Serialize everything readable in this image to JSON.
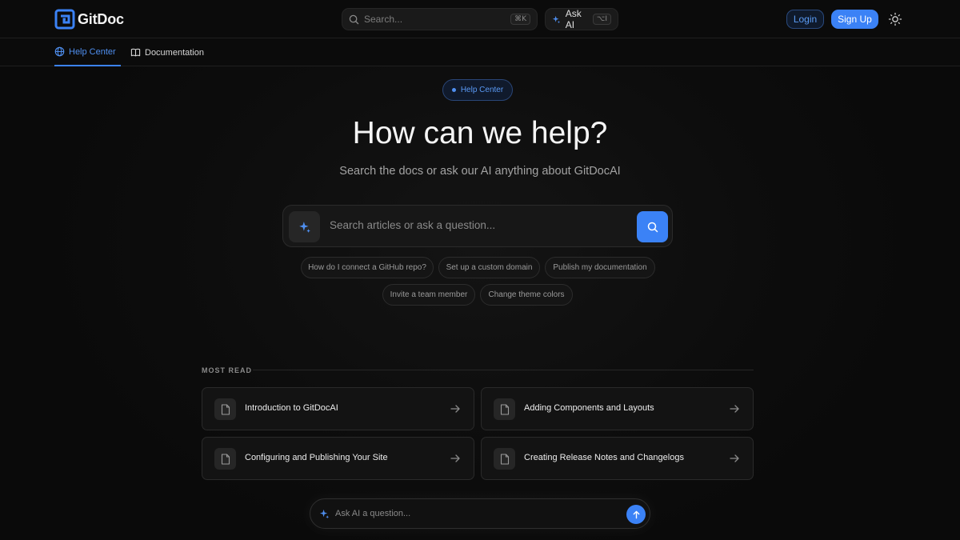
{
  "brand": {
    "name": "GitDoc",
    "accent": "#3b82f6"
  },
  "topbar": {
    "search_placeholder": "Search...",
    "search_shortcut": "⌘K",
    "ask_ai_label": "Ask AI",
    "ask_ai_shortcut": "⌥I",
    "login_label": "Login",
    "signup_label": "Sign Up",
    "theme_icon": "sun-icon"
  },
  "subnav": {
    "tabs": [
      {
        "label": "Help Center",
        "icon": "globe-icon",
        "active": true
      },
      {
        "label": "Documentation",
        "icon": "book-icon",
        "active": false
      }
    ]
  },
  "hero": {
    "badge": "Help Center",
    "title": "How can we help?",
    "subtitle": "Search the docs or ask our AI anything about GitDocAI",
    "search_placeholder": "Search articles or ask a question..."
  },
  "suggestions": [
    "How do I connect a GitHub repo?",
    "Set up a custom domain",
    "Publish my documentation",
    "Invite a team member",
    "Change theme colors"
  ],
  "most_read": {
    "label": "MOST READ",
    "articles": [
      "Introduction to GitDocAI",
      "Adding Components and Layouts",
      "Configuring and Publishing Your Site",
      "Creating Release Notes and Changelogs"
    ]
  },
  "ask_bar": {
    "placeholder": "Ask AI a question..."
  }
}
